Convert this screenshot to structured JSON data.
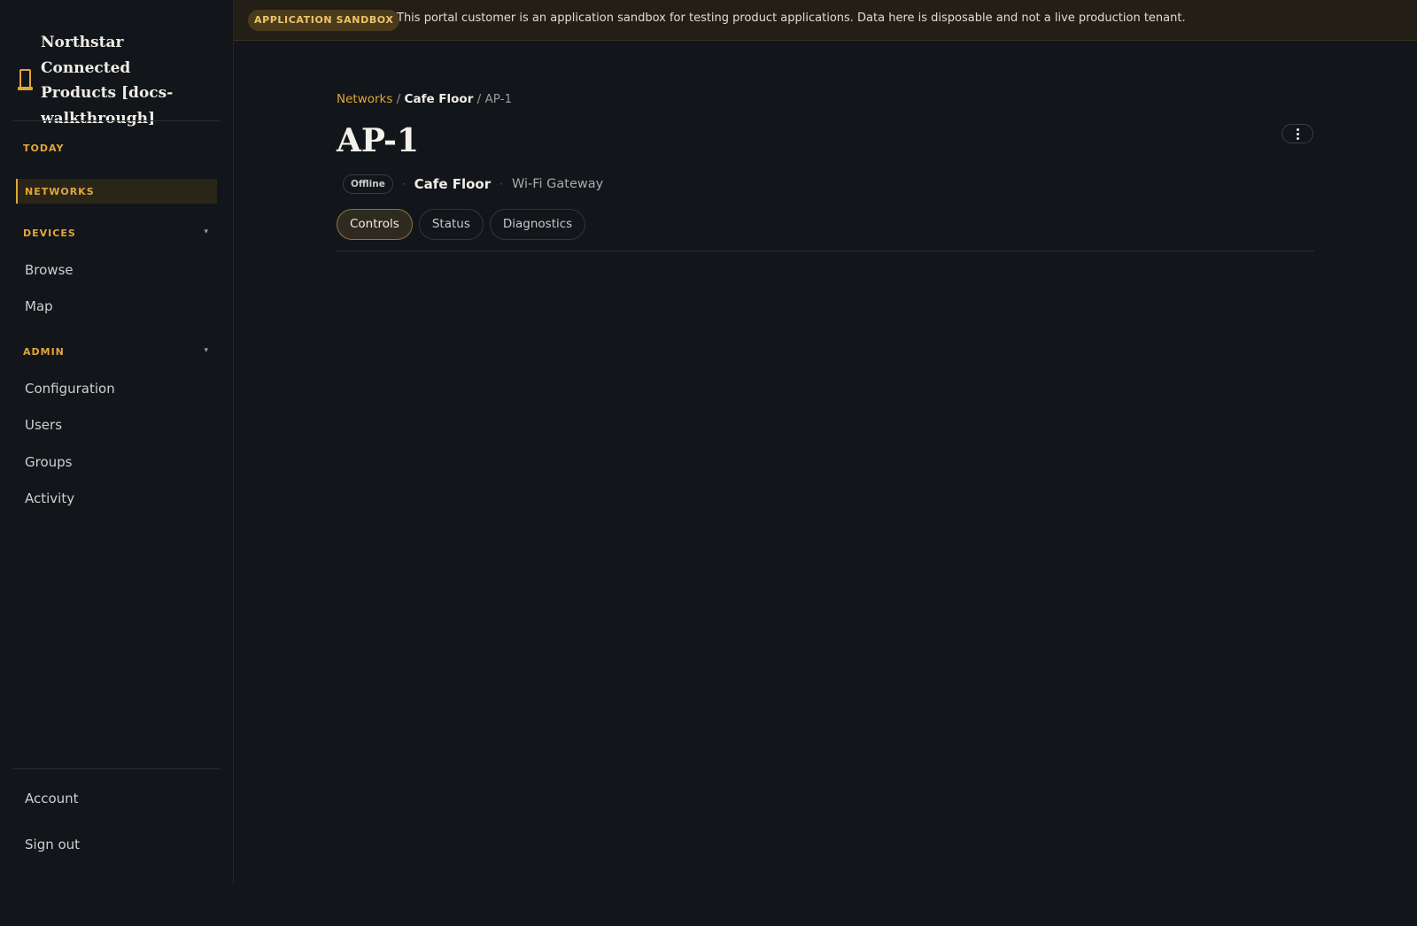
{
  "brand": {
    "title": "Northstar Connected Products [docs-walkthrough]",
    "icon": "device-icon"
  },
  "sidebar": {
    "today": "TODAY",
    "networks": "NETWORKS",
    "devices": {
      "label": "DEVICES",
      "caret": "▾",
      "items": [
        {
          "label": "Browse"
        },
        {
          "label": "Map"
        }
      ]
    },
    "admin": {
      "label": "ADMIN",
      "caret": "▾",
      "items": [
        {
          "label": "Configuration"
        },
        {
          "label": "Users"
        },
        {
          "label": "Groups"
        },
        {
          "label": "Activity"
        }
      ]
    },
    "footer": [
      {
        "label": "Account"
      },
      {
        "label": "Sign out"
      }
    ]
  },
  "banner": {
    "badge": "APPLICATION SANDBOX",
    "text": "This portal customer is an application sandbox for testing product applications. Data here is disposable and not a live production tenant."
  },
  "breadcrumb": {
    "root": "Networks",
    "sep1": " / ",
    "network": "Cafe Floor",
    "sep2": " / ",
    "current": "AP-1"
  },
  "device": {
    "title": "AP-1",
    "status": "Offline",
    "network": "Cafe Floor",
    "type": "Wi-Fi Gateway",
    "separator": "·"
  },
  "tabs": [
    {
      "label": "Controls",
      "active": true
    },
    {
      "label": "Status"
    },
    {
      "label": "Diagnostics"
    }
  ],
  "colors": {
    "accent": "#e2a53a",
    "background": "#121519",
    "banner": "#241f16"
  }
}
